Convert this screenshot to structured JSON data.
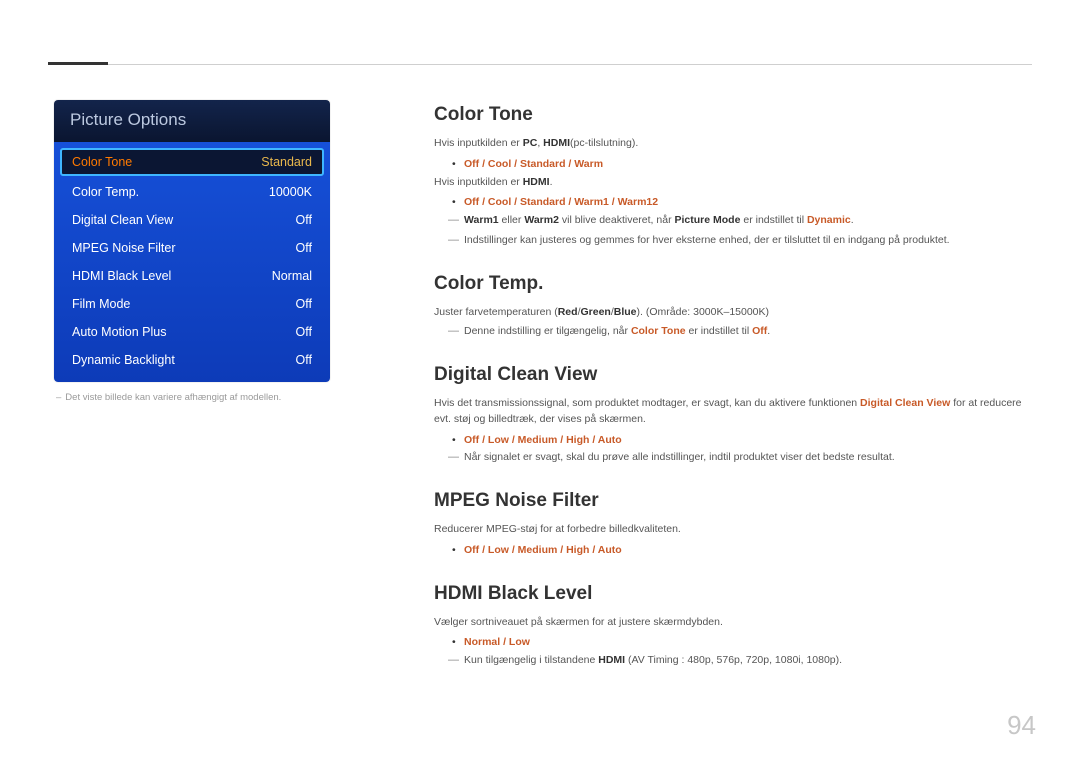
{
  "menu": {
    "title": "Picture Options",
    "rows": [
      {
        "label": "Color Tone",
        "value": "Standard",
        "selected": true
      },
      {
        "label": "Color Temp.",
        "value": "10000K"
      },
      {
        "label": "Digital Clean View",
        "value": "Off"
      },
      {
        "label": "MPEG Noise Filter",
        "value": "Off"
      },
      {
        "label": "HDMI Black Level",
        "value": "Normal"
      },
      {
        "label": "Film Mode",
        "value": "Off"
      },
      {
        "label": "Auto Motion Plus",
        "value": "Off"
      },
      {
        "label": "Dynamic Backlight",
        "value": "Off"
      }
    ],
    "caption": "Det viste billede kan variere afhængigt af modellen."
  },
  "sections": {
    "colorTone": {
      "title": "Color Tone",
      "line1_a": "Hvis inputkilden er ",
      "line1_b_hl": "PC",
      "line1_c": ", ",
      "line1_d_hl": "HDMI",
      "line1_e": "(pc-tilslutning).",
      "bullet1": "Off / Cool / Standard / Warm",
      "line2_a": "Hvis inputkilden er ",
      "line2_b_hl": "HDMI",
      "line2_c": ".",
      "bullet2": "Off / Cool / Standard / Warm1 / Warm12",
      "dash1_a_hl": "Warm1",
      "dash1_b": " eller ",
      "dash1_c_hl": "Warm2",
      "dash1_d": " vil blive deaktiveret, når ",
      "dash1_e_hl": "Picture Mode",
      "dash1_f": " er indstillet til ",
      "dash1_g_hl": "Dynamic",
      "dash1_h": ".",
      "dash2": "Indstillinger kan justeres og gemmes for hver eksterne enhed, der er tilsluttet til en indgang på produktet."
    },
    "colorTemp": {
      "title": "Color Temp.",
      "line1_a": "Juster farvetemperaturen (",
      "line1_b_hl": "Red",
      "line1_c": "/",
      "line1_d_hl": "Green",
      "line1_e": "/",
      "line1_f_hl": "Blue",
      "line1_g": "). (Område: 3000K–15000K)",
      "dash1_a": "Denne indstilling er tilgængelig, når ",
      "dash1_b_hl": "Color Tone",
      "dash1_c": " er indstillet til ",
      "dash1_d_hl": "Off",
      "dash1_e": "."
    },
    "dcv": {
      "title": "Digital Clean View",
      "line1_a": "Hvis det transmissionssignal, som produktet modtager, er svagt, kan du aktivere funktionen ",
      "line1_b_hl": "Digital Clean View",
      "line1_c": " for at reducere evt. støj og billedtræk, der vises på skærmen.",
      "bullet1": "Off / Low / Medium / High / Auto",
      "dash1": "Når signalet er svagt, skal du prøve alle indstillinger, indtil produktet viser det bedste resultat."
    },
    "mpeg": {
      "title": "MPEG Noise Filter",
      "line1": "Reducerer MPEG-støj for at forbedre billedkvaliteten.",
      "bullet1": "Off / Low / Medium / High / Auto"
    },
    "hdmi": {
      "title": "HDMI Black Level",
      "line1": "Vælger sortniveauet på skærmen for at justere skærmdybden.",
      "bullet1": "Normal / Low",
      "dash1_a": "Kun tilgængelig i tilstandene ",
      "dash1_b_hl": "HDMI",
      "dash1_c": " (AV Timing : 480p, 576p, 720p, 1080i, 1080p)."
    }
  },
  "pageNumber": "94"
}
